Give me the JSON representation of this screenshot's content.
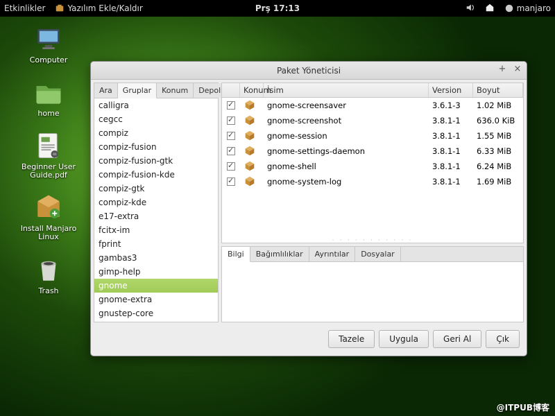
{
  "topbar": {
    "activities": "Etkinlikler",
    "app_name": "Yazılım Ekle/Kaldır",
    "clock": "Prş 17:13",
    "user": "manjaro"
  },
  "desktop": [
    {
      "label": "Computer"
    },
    {
      "label": "home"
    },
    {
      "label": "Beginner User Guide.pdf"
    },
    {
      "label": "Install Manjaro Linux"
    },
    {
      "label": "Trash"
    }
  ],
  "window": {
    "title": "Paket Yöneticisi",
    "tabs": [
      "Ara",
      "Gruplar",
      "Konum",
      "Depolar"
    ],
    "active_tab": 1,
    "groups": [
      "calligra",
      "cegcc",
      "compiz",
      "compiz-fusion",
      "compiz-fusion-gtk",
      "compiz-fusion-kde",
      "compiz-gtk",
      "compiz-kde",
      "e17-extra",
      "fcitx-im",
      "fprint",
      "gambas3",
      "gimp-help",
      "gnome",
      "gnome-extra",
      "gnustep-core"
    ],
    "selected_group": "gnome",
    "columns": {
      "c0": "",
      "c1": "Konum",
      "c2": "İsim",
      "c3": "Version",
      "c4": "Boyut"
    },
    "packages": [
      {
        "name": "gnome-screensaver",
        "version": "3.6.1-3",
        "size": "1.02 MiB"
      },
      {
        "name": "gnome-screenshot",
        "version": "3.8.1-1",
        "size": "636.0 KiB"
      },
      {
        "name": "gnome-session",
        "version": "3.8.1-1",
        "size": "1.55 MiB"
      },
      {
        "name": "gnome-settings-daemon",
        "version": "3.8.1-1",
        "size": "6.33 MiB"
      },
      {
        "name": "gnome-shell",
        "version": "3.8.1-1",
        "size": "6.24 MiB"
      },
      {
        "name": "gnome-system-log",
        "version": "3.8.1-1",
        "size": "1.69 MiB"
      }
    ],
    "detail_tabs": [
      "Bilgi",
      "Bağımlılıklar",
      "Ayrıntılar",
      "Dosyalar"
    ],
    "buttons": {
      "refresh": "Tazele",
      "apply": "Uygula",
      "undo": "Geri Al",
      "quit": "Çık"
    }
  },
  "watermark": "@ITPUB博客"
}
